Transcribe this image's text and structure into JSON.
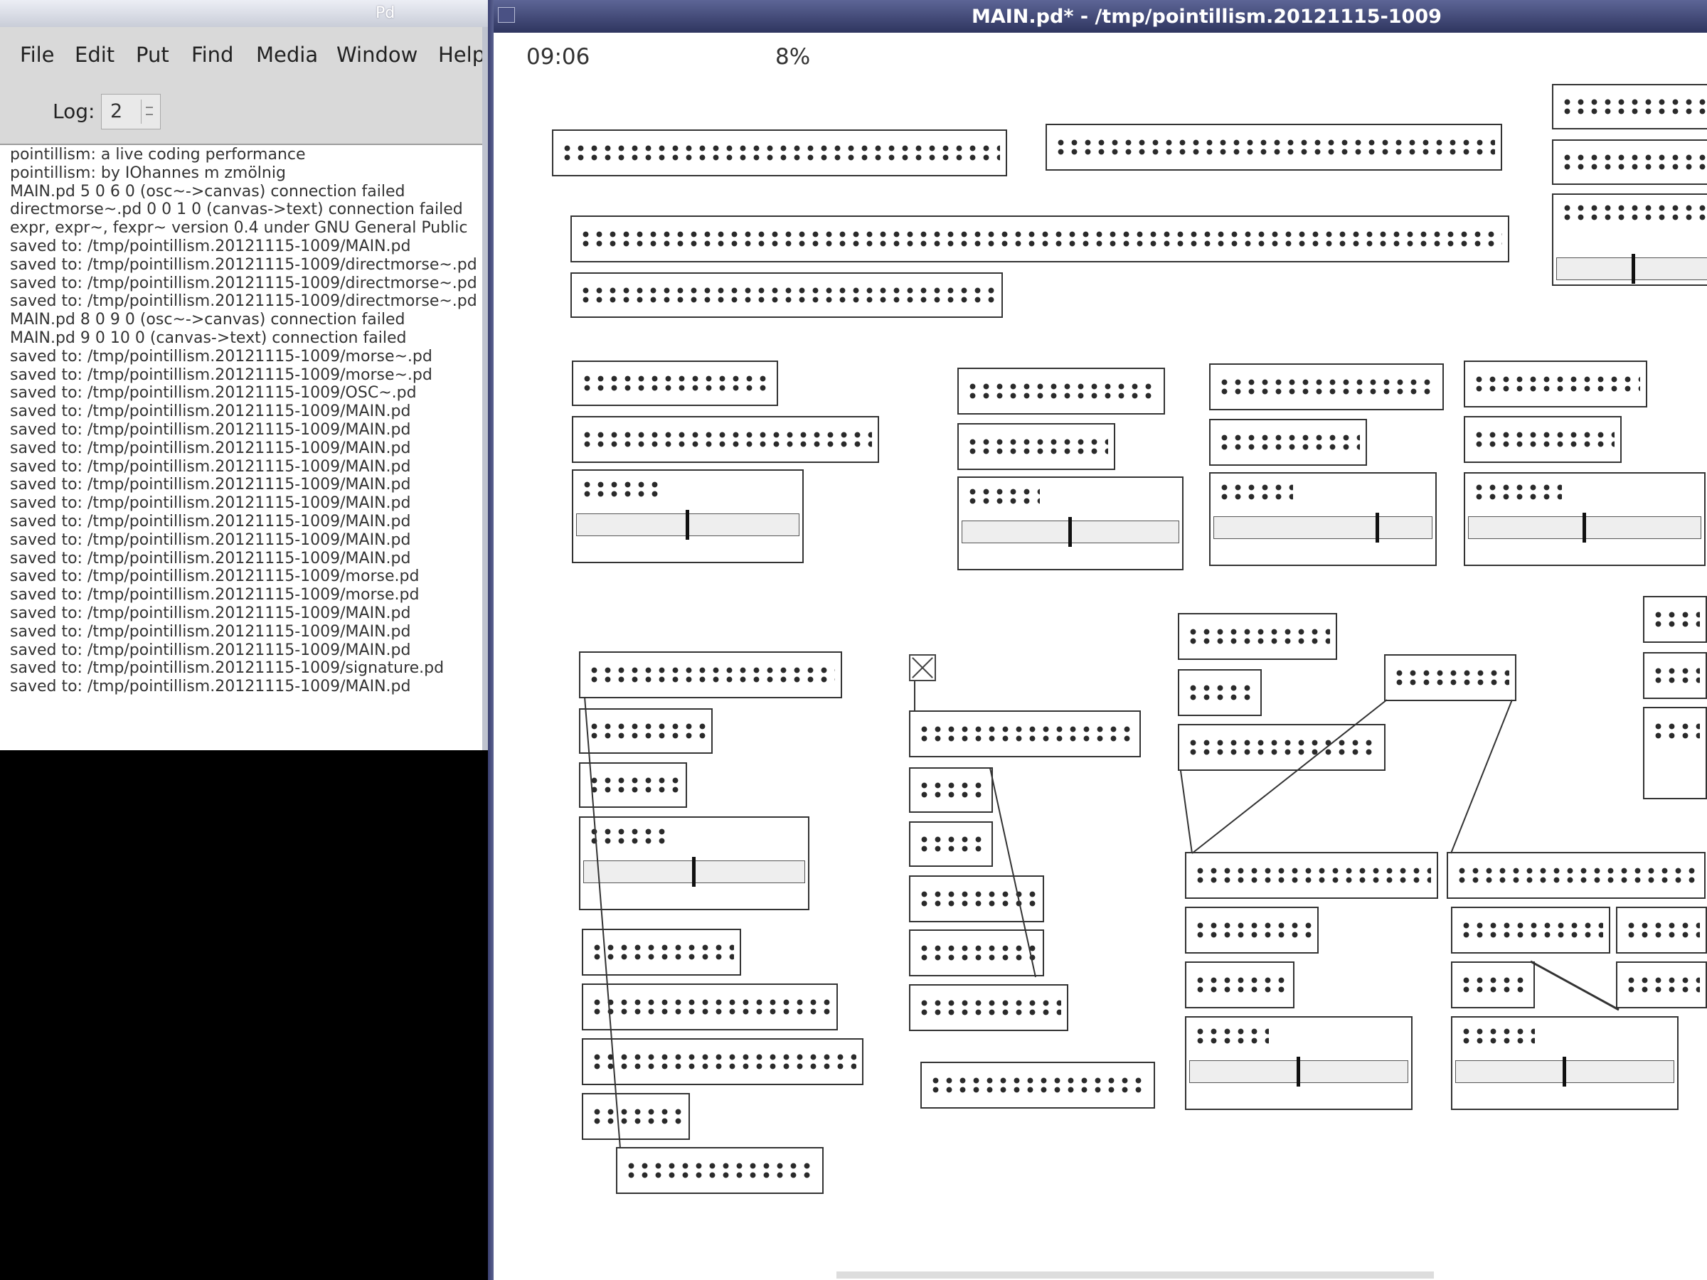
{
  "console": {
    "title": "Pd",
    "menu": [
      "File",
      "Edit",
      "Put",
      "Find",
      "Media",
      "Window",
      "Help"
    ],
    "log_label": "Log:",
    "log_level": "2",
    "lines": [
      "pointillism: a live coding performance",
      "pointillism: by IOhannes m zmölnig",
      "MAIN.pd 5 0 6 0 (osc~->canvas) connection failed",
      "directmorse~.pd 0 0 1 0 (canvas->text) connection failed",
      "expr, expr~, fexpr~ version 0.4 under GNU General Public",
      "saved to: /tmp/pointillism.20121115-1009/MAIN.pd",
      "saved to: /tmp/pointillism.20121115-1009/directmorse~.pd",
      "saved to: /tmp/pointillism.20121115-1009/directmorse~.pd",
      "saved to: /tmp/pointillism.20121115-1009/directmorse~.pd",
      "MAIN.pd 8 0 9 0 (osc~->canvas) connection failed",
      "MAIN.pd 9 0 10 0 (canvas->text) connection failed",
      "saved to: /tmp/pointillism.20121115-1009/morse~.pd",
      "saved to: /tmp/pointillism.20121115-1009/morse~.pd",
      "saved to: /tmp/pointillism.20121115-1009/OSC~.pd",
      "saved to: /tmp/pointillism.20121115-1009/MAIN.pd",
      "saved to: /tmp/pointillism.20121115-1009/MAIN.pd",
      "saved to: /tmp/pointillism.20121115-1009/MAIN.pd",
      "saved to: /tmp/pointillism.20121115-1009/MAIN.pd",
      "saved to: /tmp/pointillism.20121115-1009/MAIN.pd",
      "saved to: /tmp/pointillism.20121115-1009/MAIN.pd",
      "saved to: /tmp/pointillism.20121115-1009/MAIN.pd",
      "saved to: /tmp/pointillism.20121115-1009/MAIN.pd",
      "saved to: /tmp/pointillism.20121115-1009/MAIN.pd",
      "saved to: /tmp/pointillism.20121115-1009/morse.pd",
      "saved to: /tmp/pointillism.20121115-1009/morse.pd",
      "saved to: /tmp/pointillism.20121115-1009/MAIN.pd",
      "saved to: /tmp/pointillism.20121115-1009/MAIN.pd",
      "saved to: /tmp/pointillism.20121115-1009/MAIN.pd",
      "saved to: /tmp/pointillism.20121115-1009/signature.pd",
      "saved to: /tmp/pointillism.20121115-1009/MAIN.pd"
    ]
  },
  "patch": {
    "title": "MAIN.pd* - /tmp/pointillism.20121115-1009",
    "clock": "09:06",
    "cpu": "8%",
    "slider_levels": [
      0.5,
      0.5,
      0.5,
      0.75,
      0.5,
      0.5
    ]
  }
}
